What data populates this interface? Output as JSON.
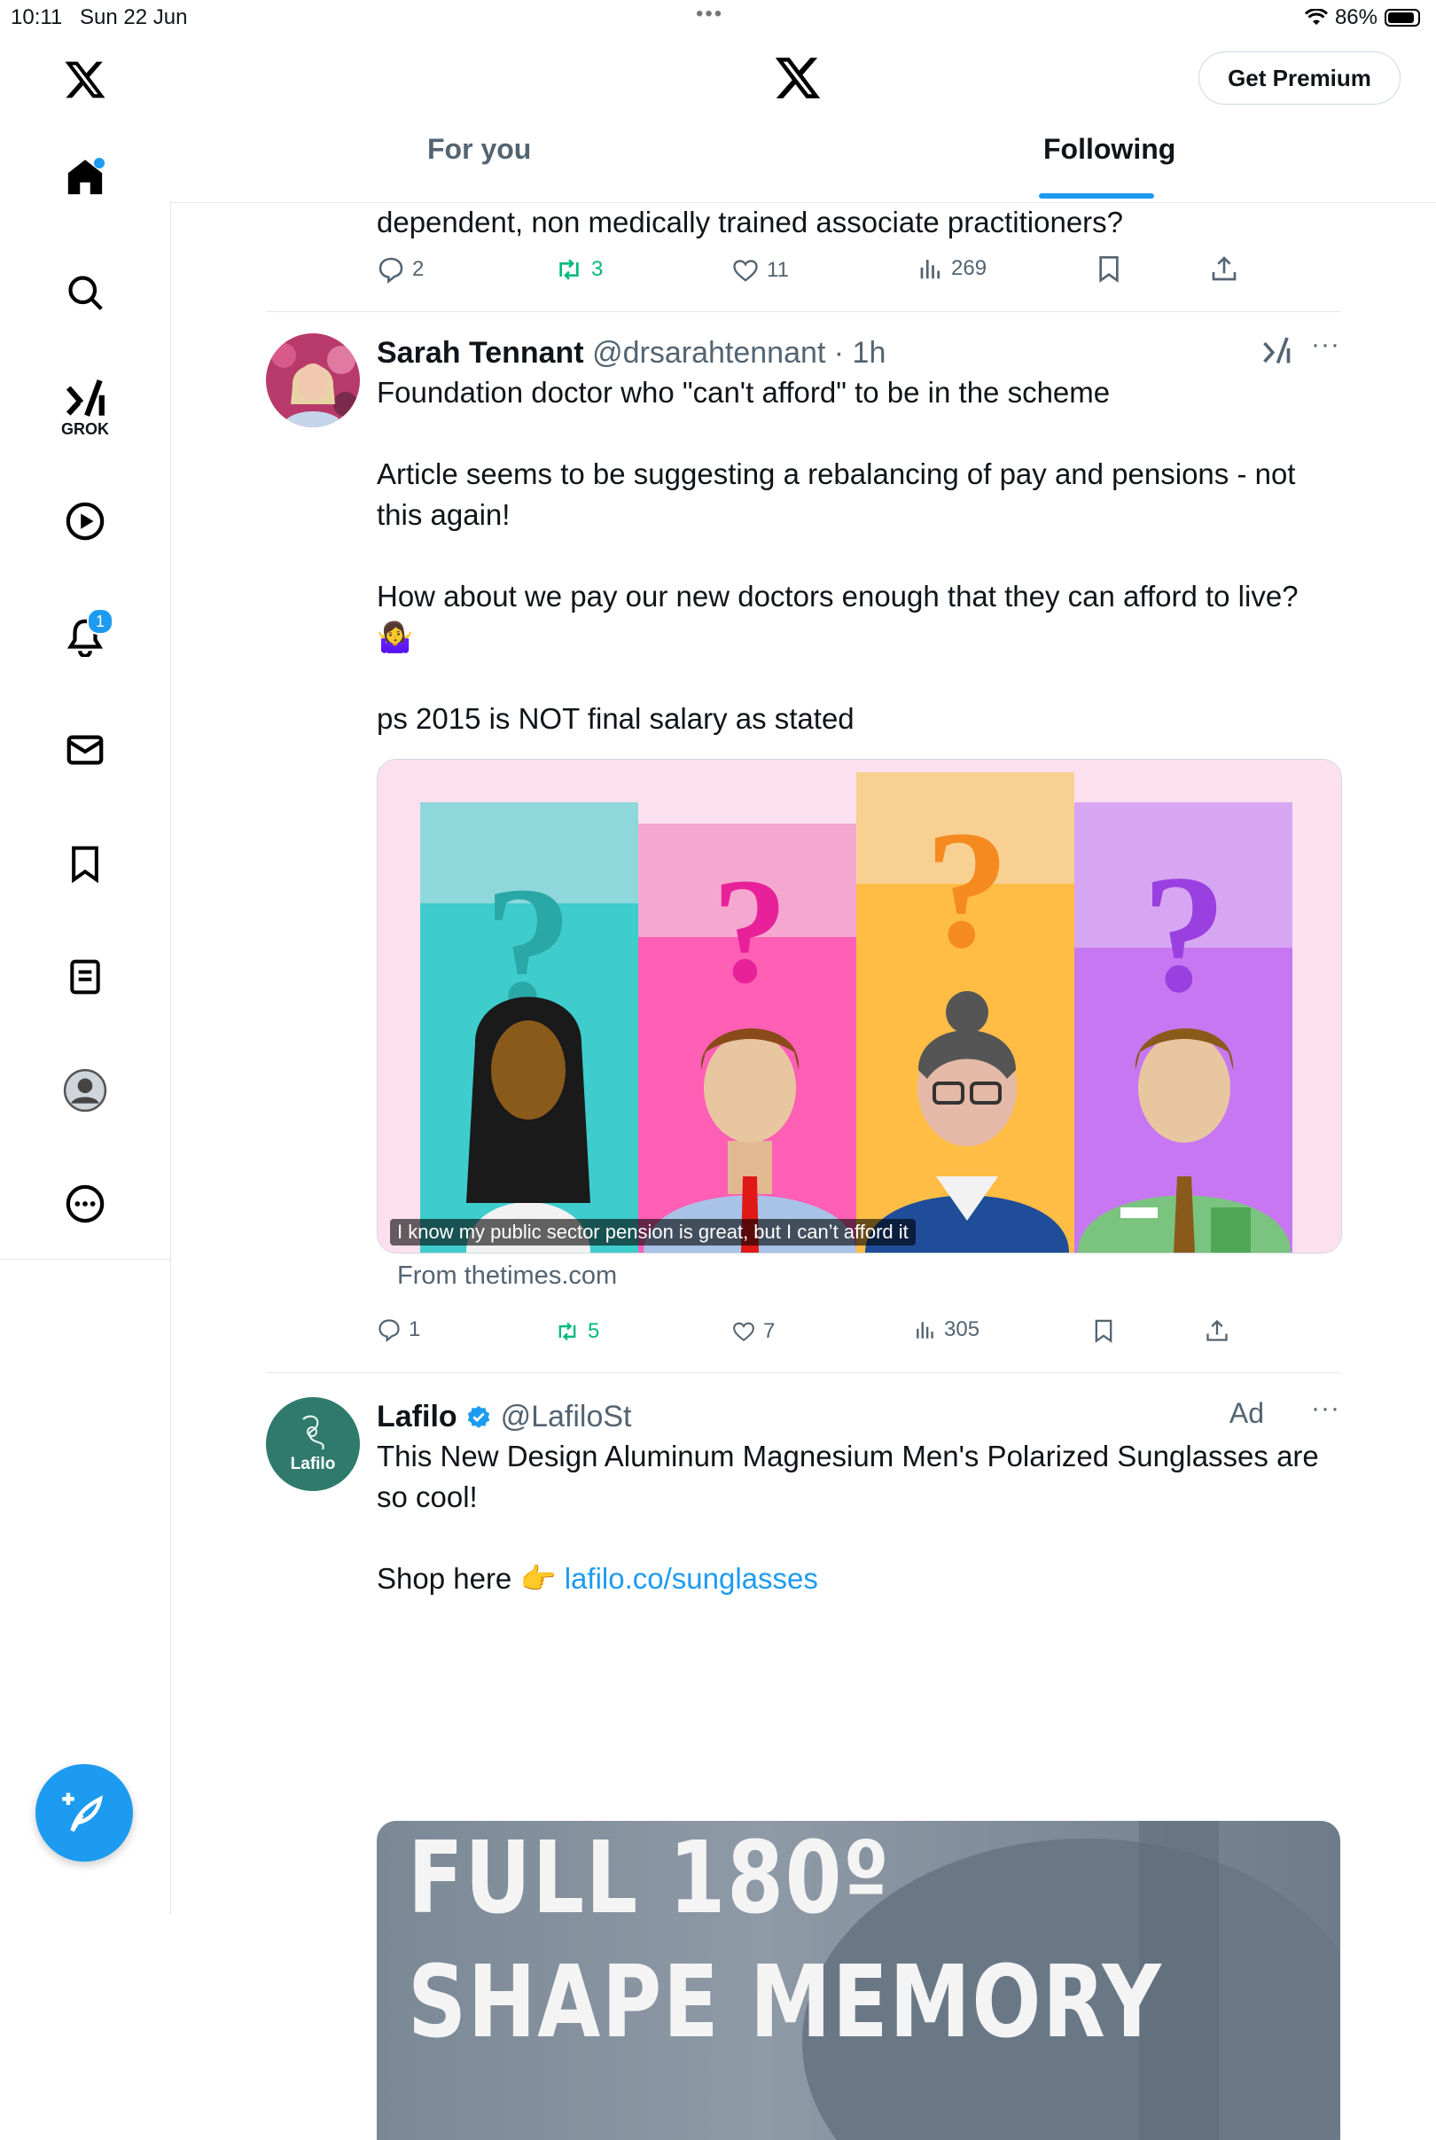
{
  "status_bar": {
    "time": "10:11",
    "date": "Sun 22 Jun",
    "battery": "86%"
  },
  "sidebar": {
    "items": [
      {
        "name": "x-logo-icon"
      },
      {
        "name": "home-icon"
      },
      {
        "name": "search-icon"
      },
      {
        "name": "grok-icon",
        "label": "GROK"
      },
      {
        "name": "video-icon"
      },
      {
        "name": "notifications-icon",
        "badge": "1"
      },
      {
        "name": "messages-icon"
      },
      {
        "name": "bookmarks-icon"
      },
      {
        "name": "lists-icon"
      },
      {
        "name": "profile-icon"
      },
      {
        "name": "more-icon"
      }
    ]
  },
  "header": {
    "premium_label": "Get Premium",
    "tabs": [
      {
        "label": "For you"
      },
      {
        "label": "Following",
        "active": true
      }
    ]
  },
  "tweets": [
    {
      "text": "dependent, non medically trained associate practitioners?",
      "replies": "2",
      "reposts": "3",
      "likes": "11",
      "views": "269"
    },
    {
      "name": "Sarah Tennant",
      "handle": "@drsarahtennant",
      "time": "· 1h",
      "line1": "Foundation doctor who \"can't afford\" to be in the scheme",
      "line2": "Article seems to be suggesting a rebalancing of pay and pensions - not this again!",
      "line3": "How about we pay our new doctors enough that they can afford to live?",
      "emoji": "🤷‍♀️",
      "line4": "ps 2015 is NOT final salary as stated",
      "card_caption": "I know my public sector pension is great, but I can’t afford it",
      "card_source": "From thetimes.com",
      "replies": "1",
      "reposts": "5",
      "likes": "7",
      "views": "305"
    },
    {
      "name": "Lafilo",
      "handle": "@LafiloSt",
      "ad_label": "Ad",
      "avatar_text": "Lafilo",
      "line1": "This New Design Aluminum Magnesium Men's Polarized Sunglasses are so cool!",
      "shop_text": "Shop here 👉",
      "link": "lafilo.co/sunglasses",
      "image_text_1": "FULL 180º",
      "image_text_2": "SHAPE MEMORY"
    }
  ],
  "colors": {
    "accent": "#1d9bf0",
    "repost": "#00ba7c",
    "muted": "#536471"
  }
}
